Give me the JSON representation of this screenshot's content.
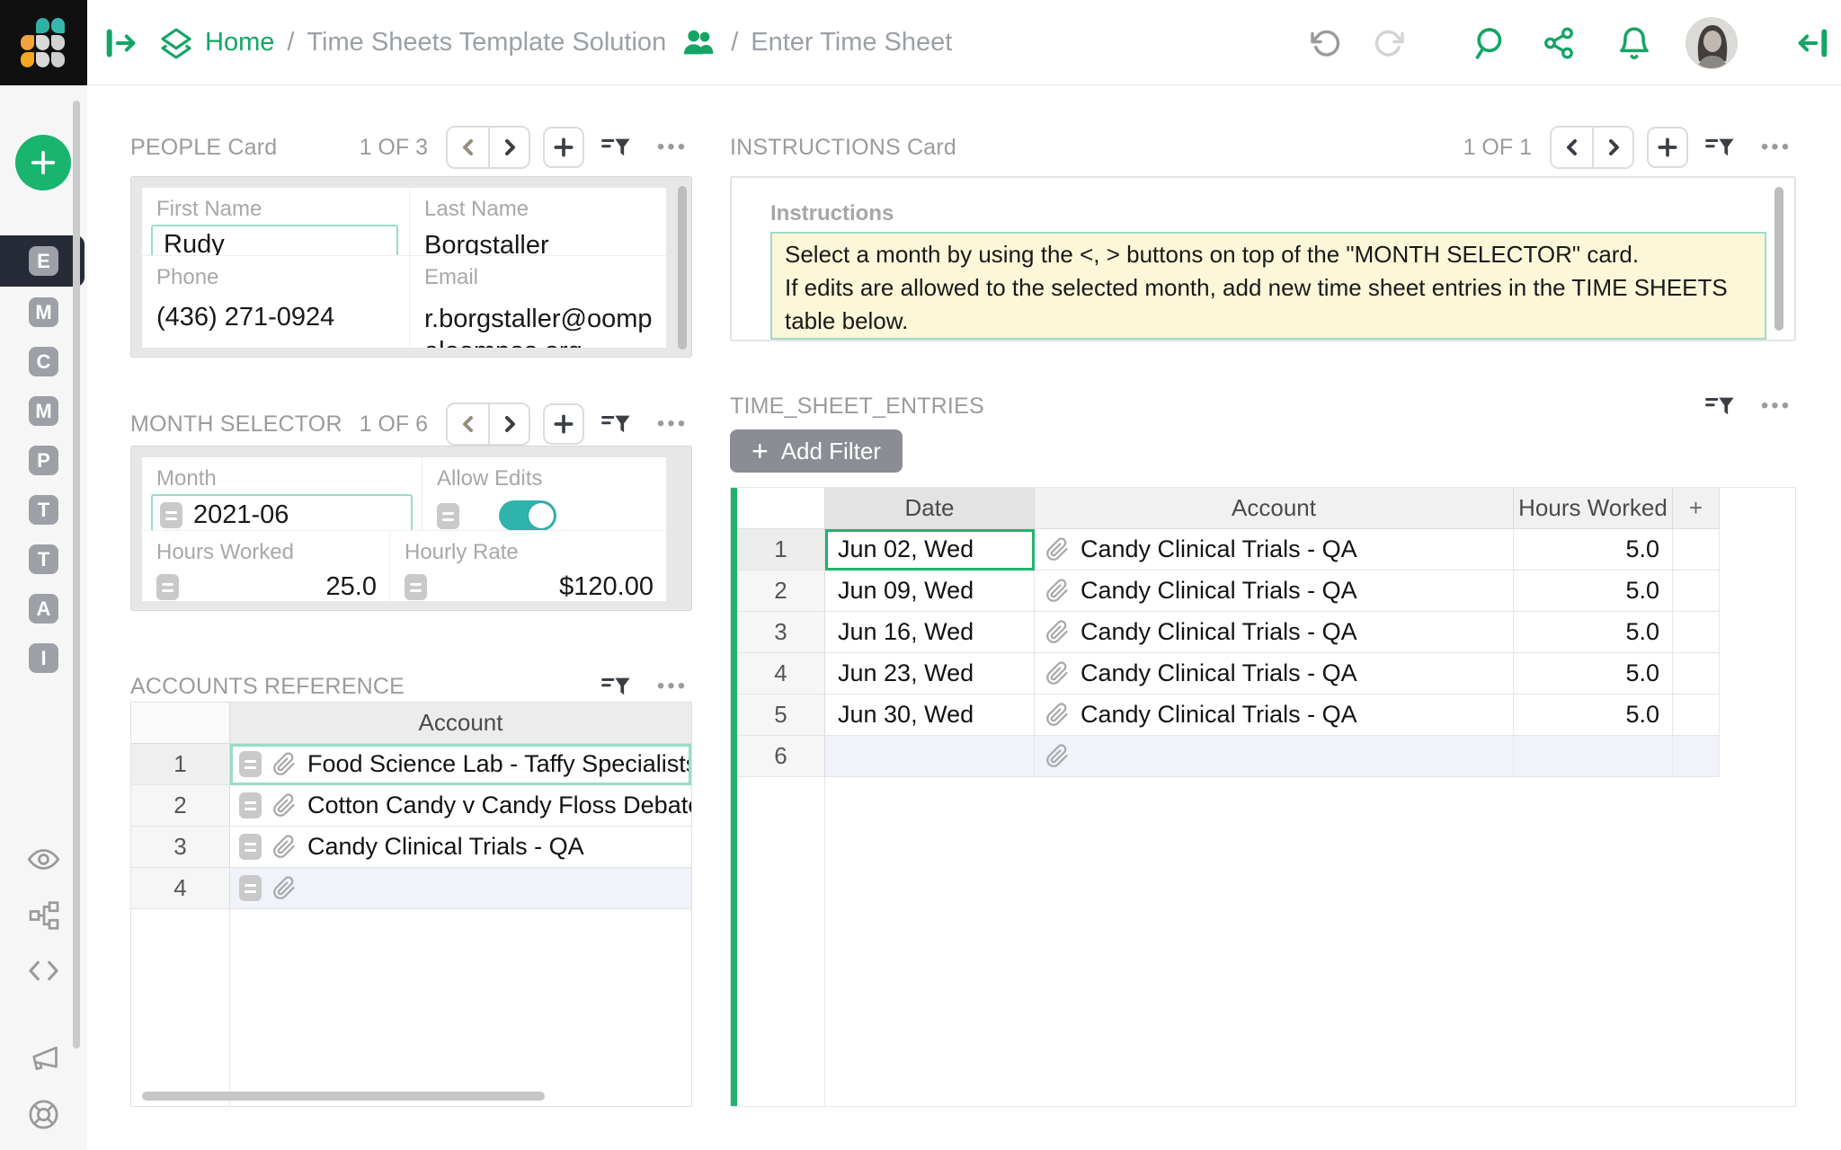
{
  "topbar": {
    "breadcrumb": {
      "home": "Home",
      "sep1": "/",
      "solution": "Time Sheets Template Solution",
      "sep2": "/",
      "screen": "Enter Time Sheet"
    }
  },
  "icons": {
    "dots": "•••"
  },
  "sidebar": {
    "tiles": [
      {
        "label": "E"
      },
      {
        "label": "M"
      },
      {
        "label": "C"
      },
      {
        "label": "M"
      },
      {
        "label": "P"
      },
      {
        "label": "T"
      },
      {
        "label": "T"
      },
      {
        "label": "A"
      },
      {
        "label": "I"
      }
    ]
  },
  "people_card": {
    "title": "PEOPLE Card",
    "pager": "1 OF 3",
    "first_name_label": "First Name",
    "first_name": "Rudy",
    "last_name_label": "Last Name",
    "last_name": "Borgstaller",
    "phone_label": "Phone",
    "phone": "(436) 271-0924",
    "email_label": "Email",
    "email": "r.borgstaller@oompaloompas.org"
  },
  "month_selector": {
    "title": "MONTH SELECTOR",
    "pager": "1 OF 6",
    "month_label": "Month",
    "month": "2021-06",
    "allow_edits_label": "Allow Edits",
    "allow_edits_on": true,
    "hours_worked_label": "Hours Worked",
    "hours_worked": "25.0",
    "hourly_rate_label": "Hourly Rate",
    "hourly_rate": "$120.00"
  },
  "accounts_reference": {
    "title": "ACCOUNTS REFERENCE",
    "column_header": "Account",
    "rows": [
      {
        "num": "1",
        "account": "Food Science Lab - Taffy Specialists -"
      },
      {
        "num": "2",
        "account": "Cotton Candy v Candy Floss Debate T"
      },
      {
        "num": "3",
        "account": "Candy Clinical Trials - QA"
      },
      {
        "num": "4",
        "account": ""
      }
    ]
  },
  "instructions_card": {
    "title": "INSTRUCTIONS Card",
    "pager": "1 OF 1",
    "field_label": "Instructions",
    "line1": "Select a month by using the <, > buttons on top of the \"MONTH SELECTOR\" card.",
    "line2": "If edits are allowed to the selected month, add new time sheet entries in the TIME SHEETS table below."
  },
  "time_sheet_entries": {
    "title": "TIME_SHEET_ENTRIES",
    "add_filter_plus": "+",
    "add_filter_label": "Add Filter",
    "columns": {
      "date": "Date",
      "account": "Account",
      "hours": "Hours Worked",
      "add": "+"
    },
    "rows": [
      {
        "num": "1",
        "date": "Jun 02, Wed",
        "account": "Candy Clinical Trials - QA",
        "hours": "5.0"
      },
      {
        "num": "2",
        "date": "Jun 09, Wed",
        "account": "Candy Clinical Trials - QA",
        "hours": "5.0"
      },
      {
        "num": "3",
        "date": "Jun 16, Wed",
        "account": "Candy Clinical Trials - QA",
        "hours": "5.0"
      },
      {
        "num": "4",
        "date": "Jun 23, Wed",
        "account": "Candy Clinical Trials - QA",
        "hours": "5.0"
      },
      {
        "num": "5",
        "date": "Jun 30, Wed",
        "account": "Candy Clinical Trials - QA",
        "hours": "5.0"
      },
      {
        "num": "6",
        "date": "",
        "account": "",
        "hours": ""
      }
    ]
  },
  "colors": {
    "brand_green": "#14a565",
    "fab_green": "#19b46e",
    "selection_green": "#21b26e",
    "mint_outline": "#99dcc4",
    "toggle_teal": "#2fb3ab",
    "instructions_yellow": "#fbf7d8",
    "new_row_lavender": "#f1f3fb",
    "logo_teal": "#2fb0a5",
    "logo_orange": "#f2a33c"
  }
}
